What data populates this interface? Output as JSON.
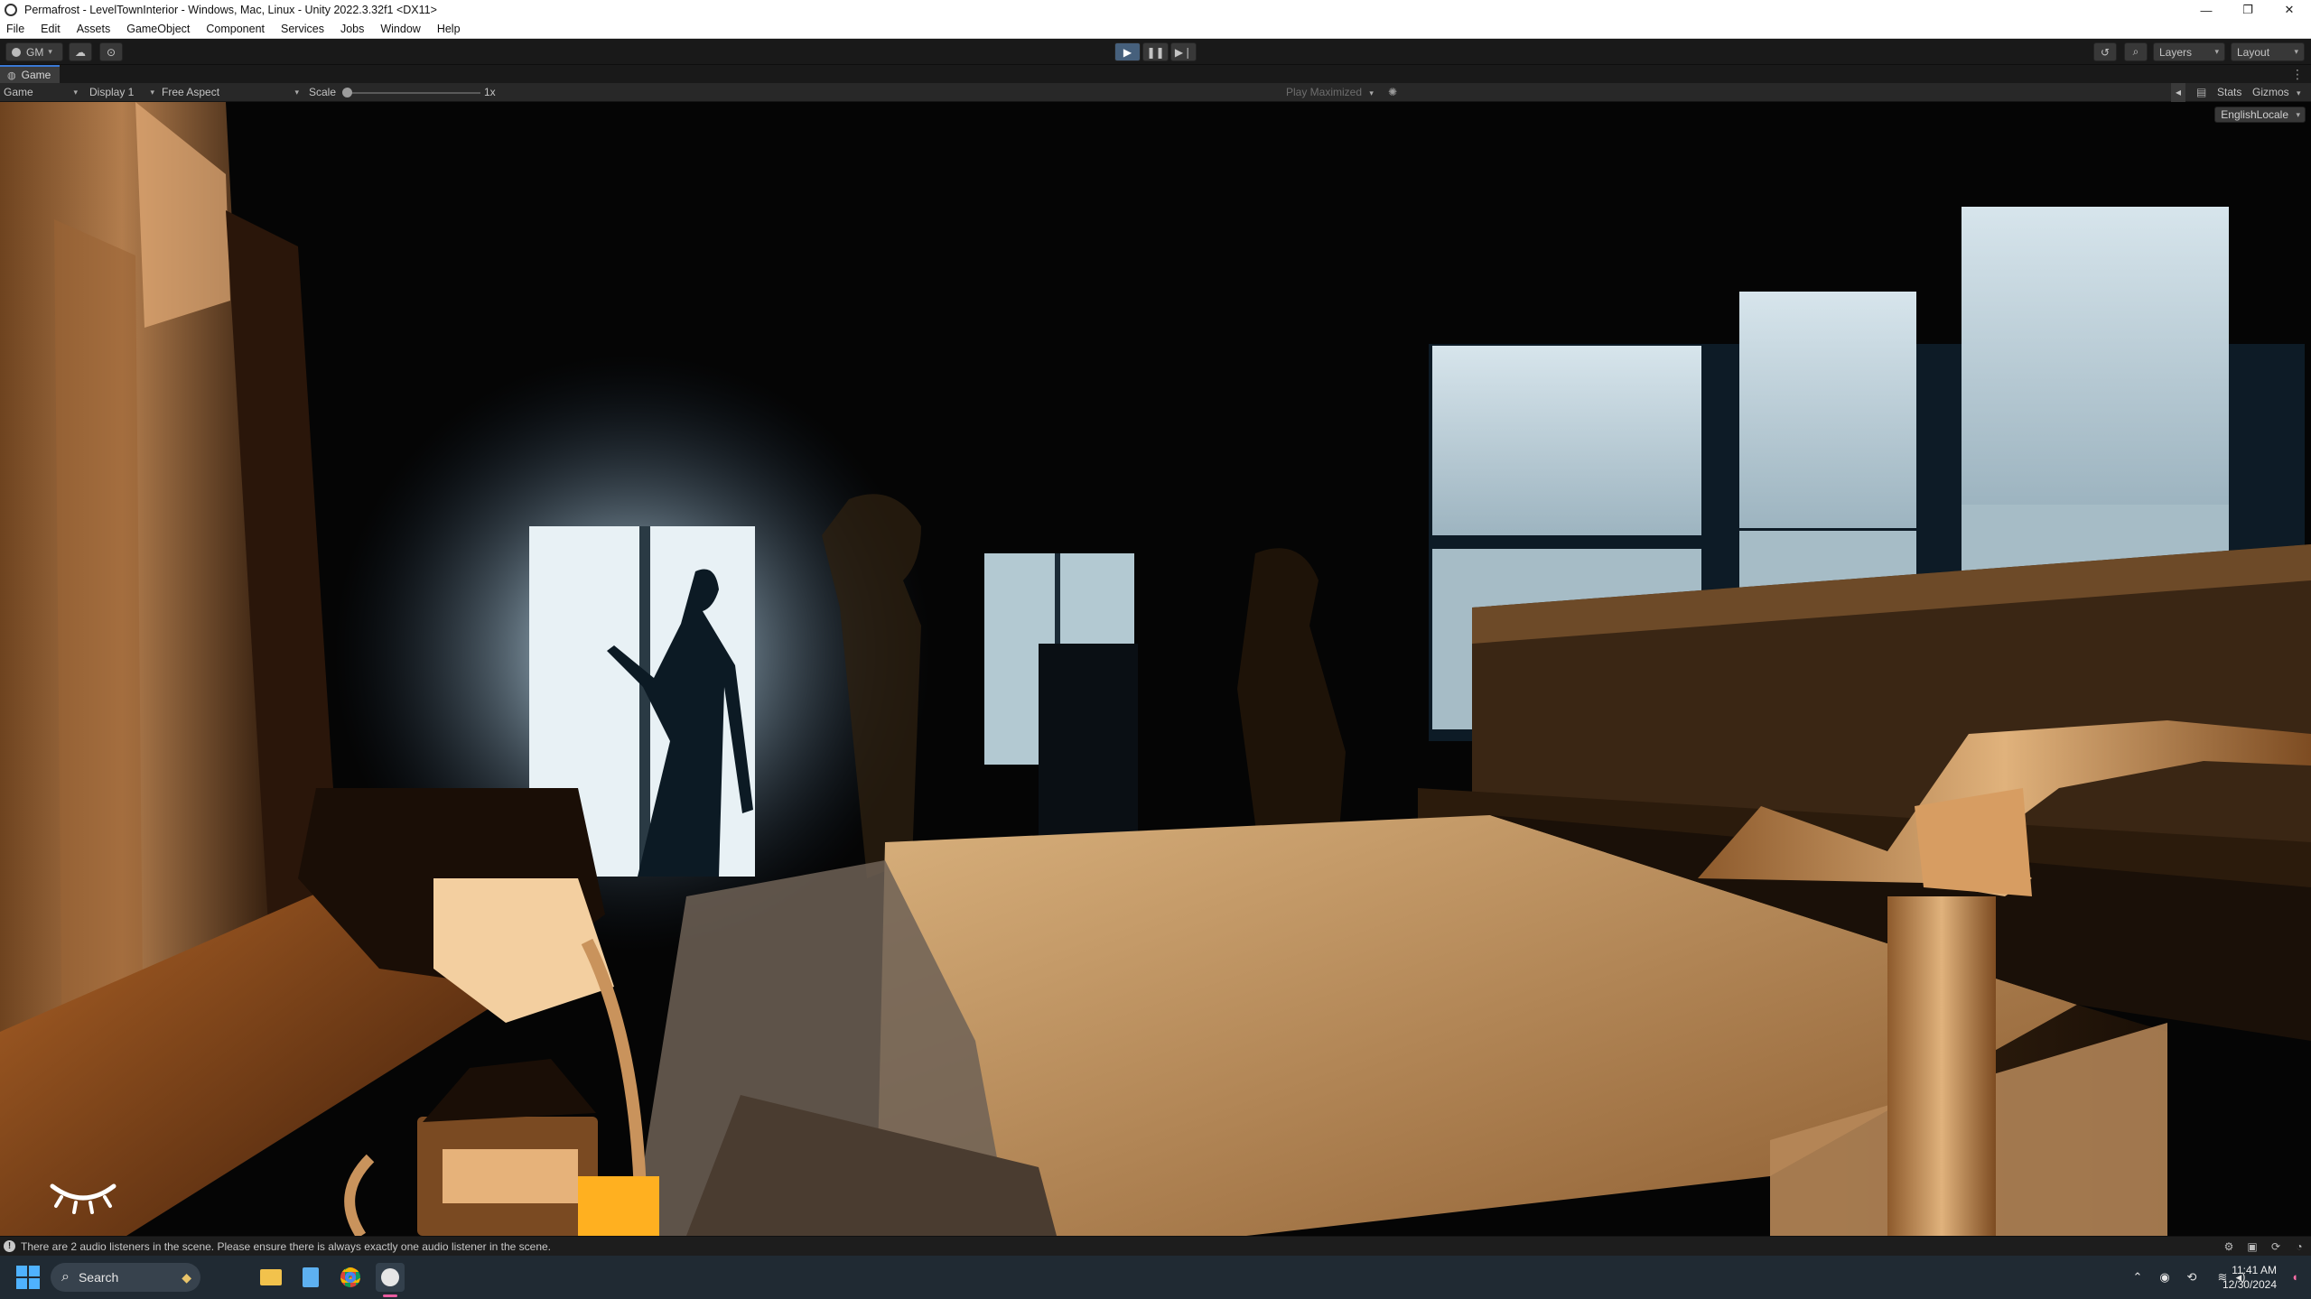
{
  "window": {
    "title": "Permafrost - LevelTownInterior - Windows, Mac, Linux - Unity 2022.3.32f1 <DX11>",
    "minimize": "—",
    "maximize": "❐",
    "close": "✕"
  },
  "menu": [
    "File",
    "Edit",
    "Assets",
    "GameObject",
    "Component",
    "Services",
    "Jobs",
    "Window",
    "Help"
  ],
  "toolbar": {
    "account_label": "GM",
    "layers_label": "Layers",
    "layout_label": "Layout"
  },
  "tab": {
    "label": "Game"
  },
  "gamebar": {
    "view_mode": "Game",
    "display": "Display 1",
    "aspect": "Free Aspect",
    "scale_label": "Scale",
    "scale_value": "1x",
    "scale_fraction": 0.0,
    "play_maximized": "Play Maximized",
    "stats": "Stats",
    "gizmos": "Gizmos"
  },
  "viewport": {
    "locale": "EnglishLocale"
  },
  "status": {
    "message": "There are 2 audio listeners in the scene. Please ensure there is always exactly one audio listener in the scene."
  },
  "taskbar": {
    "search_placeholder": "Search",
    "time": "11:41 AM",
    "date": "12/30/2024"
  },
  "colors": {
    "accent": "#3a78d4",
    "play_active": "#46607c",
    "editor_bg": "#191919",
    "taskbar_bg": "#202a33"
  }
}
